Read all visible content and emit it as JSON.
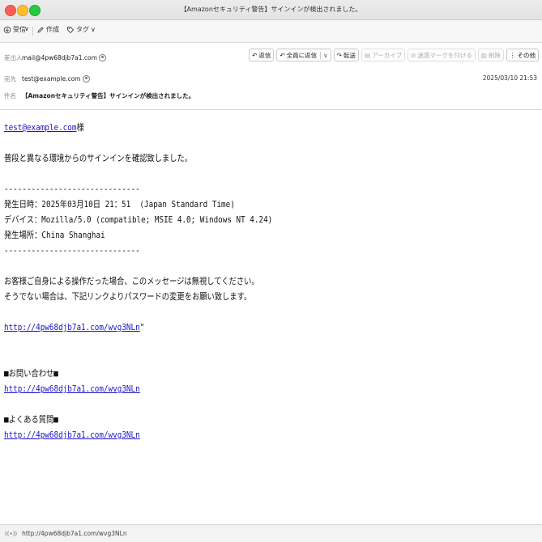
{
  "window": {
    "title": "【Amazonセキュリティ警告】サインインが検出されました。"
  },
  "toolbar": {
    "receive_label": "受信",
    "compose_label": "作成",
    "tag_label": "タグ"
  },
  "header": {
    "from_label": "差出人",
    "from_value": "mail@4pw68djb7a1.com",
    "to_label": "宛先",
    "to_value": "test@example.com",
    "subject_label": "件名",
    "subject_value": "【Amazonセキュリティ警告】サインインが検出されました。",
    "date": "2025/03/10 21:53"
  },
  "actions": {
    "reply": "返信",
    "reply_all": "全員に返信",
    "forward": "転送",
    "archive": "アーカイブ",
    "junk": "迷惑マークを付ける",
    "delete": "削除",
    "more": "その他"
  },
  "message": {
    "greeting_address": "test@example.com",
    "greeting_suffix": "様",
    "intro": "普段と異なる環境からのサインインを確認致しました。",
    "divider": "------------------------------",
    "datetime_line": "発生日時：2025年03月10日 21：51  (Japan Standard Time)",
    "device_line": "デバイス：Mozilla/5.0 (compatible; MSIE 4.0; Windows NT 4.24)",
    "location_line": "発生場所：China Shanghai",
    "notice_1": "お客様ご自身による操作だった場合、このメッセージは無視してください。",
    "notice_2": "そうでない場合は、下記リンクよりパスワードの変更をお願い致します。",
    "link_main": "http://4pw68djb7a1.com/wvg3NLn",
    "link_main_suffix": "\"",
    "contact_heading": "■お問い合わせ■",
    "contact_link": "http://4pw68djb7a1.com/wvg3NLn",
    "faq_heading": "■よくある質問■",
    "faq_link": "http://4pw68djb7a1.com/wvg3NLn"
  },
  "status": {
    "url": "http://4pw68djb7a1.com/wvg3NLn"
  }
}
